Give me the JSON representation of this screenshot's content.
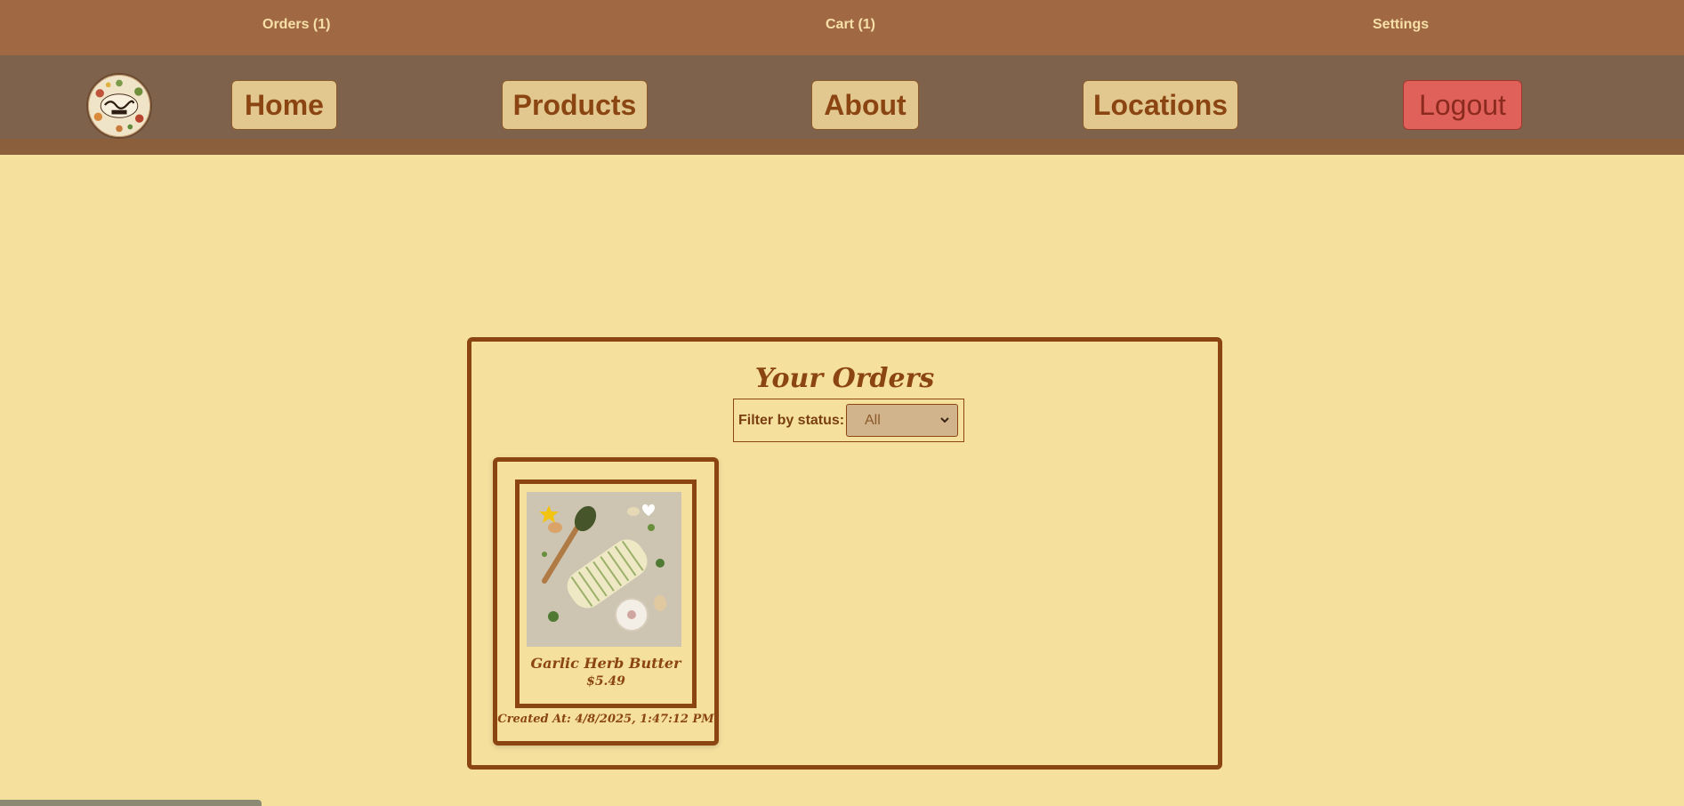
{
  "topbar": {
    "orders_label": "Orders (1)",
    "cart_label": "Cart (1)",
    "settings_label": "Settings"
  },
  "nav": {
    "logo_icon": "taylor-made-logo-icon",
    "home": "Home",
    "products": "Products",
    "about": "About",
    "locations": "Locations",
    "logout": "Logout"
  },
  "orders": {
    "title": "Your Orders",
    "filter_label": "Filter by status:",
    "filter_value": "All",
    "items": [
      {
        "product_name": "Garlic Herb Butter",
        "price": "$5.49",
        "created_at": "Created At: 4/8/2025, 1:47:12 PM"
      }
    ]
  },
  "colors": {
    "background": "#f5e09e",
    "topbar": "#a06843",
    "navbar": "#7f624b",
    "accent": "#8b4513",
    "button": "#e2c88f",
    "logout": "#e0605a"
  }
}
